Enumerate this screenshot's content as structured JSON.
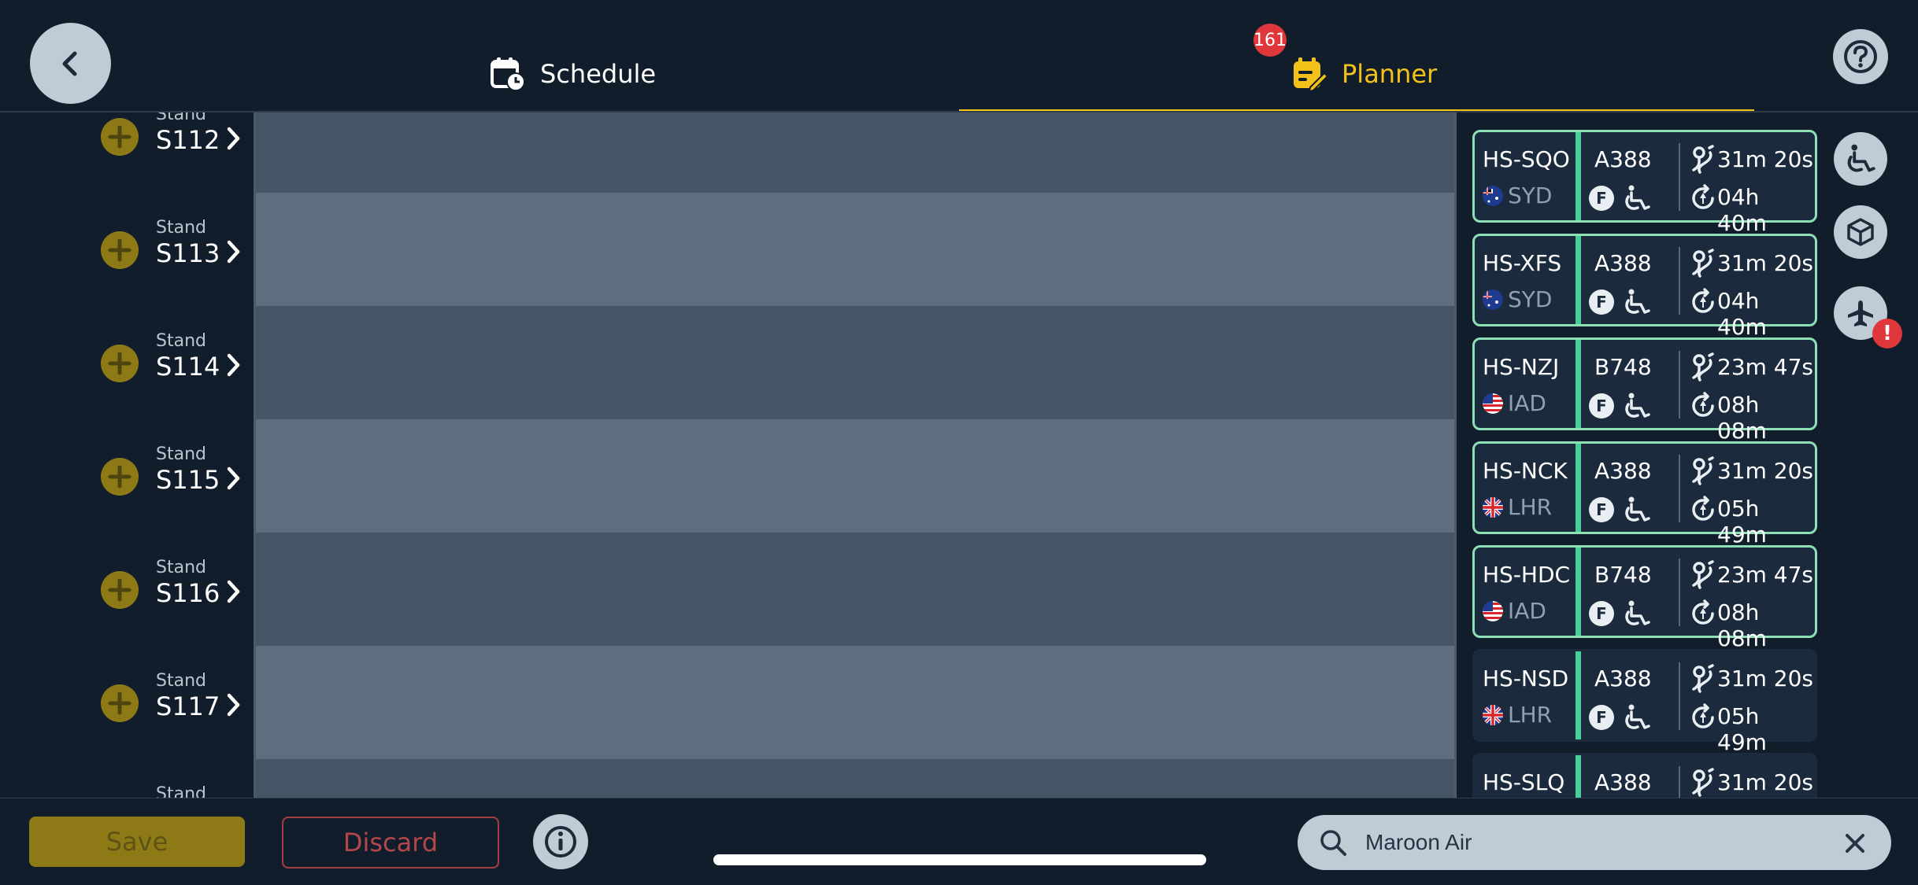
{
  "header": {
    "tabs": [
      {
        "label": "Schedule",
        "icon": "calendar-clock-icon",
        "active": false
      },
      {
        "label": "Planner",
        "icon": "calendar-edit-icon",
        "active": true,
        "badge": "161"
      }
    ]
  },
  "stands": {
    "label": "Stand",
    "items": [
      {
        "name": "S112"
      },
      {
        "name": "S113"
      },
      {
        "name": "S114"
      },
      {
        "name": "S115"
      },
      {
        "name": "S116"
      },
      {
        "name": "S117"
      }
    ]
  },
  "flights": [
    {
      "reg": "HS-SQO",
      "origin": "SYD",
      "flag": "au",
      "aircraft": "A388",
      "class": "F",
      "time1": "31m 20s",
      "time2": "04h 40m",
      "highlighted": true
    },
    {
      "reg": "HS-XFS",
      "origin": "SYD",
      "flag": "au",
      "aircraft": "A388",
      "class": "F",
      "time1": "31m 20s",
      "time2": "04h 40m",
      "highlighted": true
    },
    {
      "reg": "HS-NZJ",
      "origin": "IAD",
      "flag": "us",
      "aircraft": "B748",
      "class": "F",
      "time1": "23m 47s",
      "time2": "08h 08m",
      "highlighted": true
    },
    {
      "reg": "HS-NCK",
      "origin": "LHR",
      "flag": "gb",
      "aircraft": "A388",
      "class": "F",
      "time1": "31m 20s",
      "time2": "05h 49m",
      "highlighted": true
    },
    {
      "reg": "HS-HDC",
      "origin": "IAD",
      "flag": "us",
      "aircraft": "B748",
      "class": "F",
      "time1": "23m 47s",
      "time2": "08h 08m",
      "highlighted": true
    },
    {
      "reg": "HS-NSD",
      "origin": "LHR",
      "flag": "gb",
      "aircraft": "A388",
      "class": "F",
      "time1": "31m 20s",
      "time2": "05h 49m",
      "highlighted": false
    },
    {
      "reg": "HS-SLQ",
      "origin": "",
      "flag": "",
      "aircraft": "A388",
      "class": "",
      "time1": "31m 20s",
      "time2": "",
      "highlighted": false
    }
  ],
  "side_buttons": [
    {
      "icon": "wheelchair-icon"
    },
    {
      "icon": "cargo-box-icon"
    },
    {
      "icon": "airplane-icon",
      "alert": "!"
    }
  ],
  "footer": {
    "save_label": "Save",
    "discard_label": "Discard",
    "info_icon": "info-icon",
    "search": {
      "value": "Maroon Air",
      "placeholder": ""
    }
  },
  "colors": {
    "background": "#111d2a",
    "accent": "#f2c21b",
    "card_border": "#8de0b5",
    "card_accent": "#46d19a",
    "badge": "#e0373c",
    "discard": "#b3474c"
  }
}
